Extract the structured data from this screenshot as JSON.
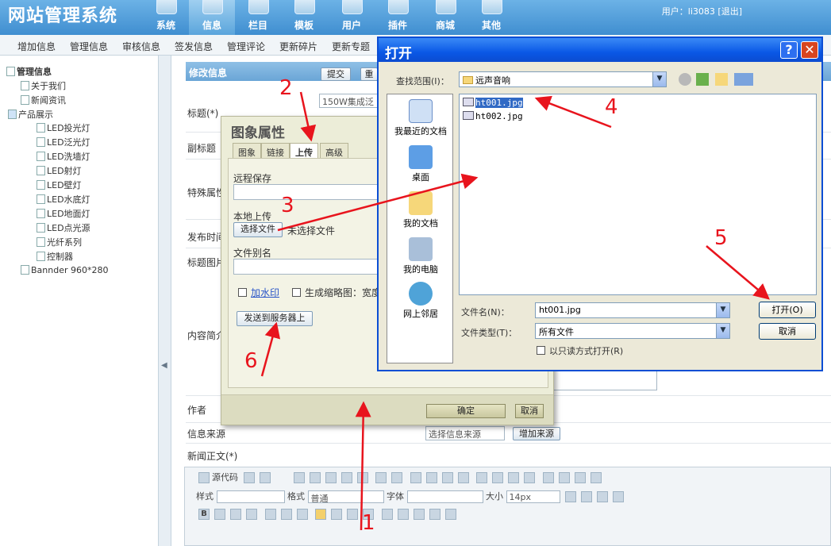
{
  "app": {
    "title": "网站管理系统",
    "user_label": "用户：li3083",
    "logout": "[退出]"
  },
  "topnav": [
    "系统",
    "信息",
    "栏目",
    "模板",
    "用户",
    "插件",
    "商城",
    "其他"
  ],
  "topnav_active": "信息",
  "subnav": [
    "增加信息",
    "管理信息",
    "审核信息",
    "签发信息",
    "管理评论",
    "更新碎片",
    "更新专题"
  ],
  "tree": {
    "root": "管理信息",
    "items": [
      "关于我们",
      "新闻资讯",
      "产品展示",
      "LED投光灯",
      "LED泛光灯",
      "LED洗墙灯",
      "LED射灯",
      "LED壁灯",
      "LED水底灯",
      "LED地面灯",
      "LED点光源",
      "光纤系列",
      "控制器",
      "Bannder 960*280"
    ]
  },
  "form": {
    "section_title": "修改信息",
    "submit": "提交",
    "reset": "重",
    "title_label": "标题(*)",
    "title_value": "150W集成泛",
    "subtitle_label": "副标题",
    "special_label": "特殊属性",
    "publish_label": "发布时间",
    "titleimg_label": "标题图片",
    "summary_label": "内容简介",
    "author_label": "作者",
    "source_label": "信息来源",
    "source_select": "选择信息来源",
    "add_source": "增加来源",
    "body_label": "新闻正文(*)"
  },
  "editor": {
    "source_code": "源代码",
    "style_label": "样式",
    "format_label": "格式",
    "format_value": "普通",
    "font_label": "字体",
    "size_label": "大小",
    "size_value": "14px"
  },
  "image_dialog": {
    "title": "图象属性",
    "tabs": [
      "图象",
      "链接",
      "上传",
      "高级"
    ],
    "active_tab": "上传",
    "remote_save": "远程保存",
    "local_upload": "本地上传",
    "choose_file": "选择文件",
    "no_file": "未选择文件",
    "alias": "文件别名",
    "watermark": "加水印",
    "thumbnail": "生成缩略图：宽度",
    "send_server": "发送到服务器上",
    "ok": "确定",
    "cancel": "取消"
  },
  "open_dialog": {
    "title": "打开",
    "lookin_label": "查找范围(I)：",
    "lookin_value": "远声音响",
    "places": [
      "我最近的文档",
      "桌面",
      "我的文档",
      "我的电脑",
      "网上邻居"
    ],
    "files": [
      "ht001.jpg",
      "ht002.jpg"
    ],
    "selected_file": "ht001.jpg",
    "filename_label": "文件名(N)：",
    "filename_value": "ht001.jpg",
    "filetype_label": "文件类型(T)：",
    "filetype_value": "所有文件",
    "readonly": "以只读方式打开(R)",
    "open": "打开(O)",
    "cancel": "取消"
  },
  "annotations": [
    "1",
    "2",
    "3",
    "4",
    "5",
    "6"
  ],
  "colors": {
    "header": "#3f8ed0",
    "annotation": "#e8141d",
    "xp_title": "#0a58e6",
    "selection": "#316ac5"
  }
}
